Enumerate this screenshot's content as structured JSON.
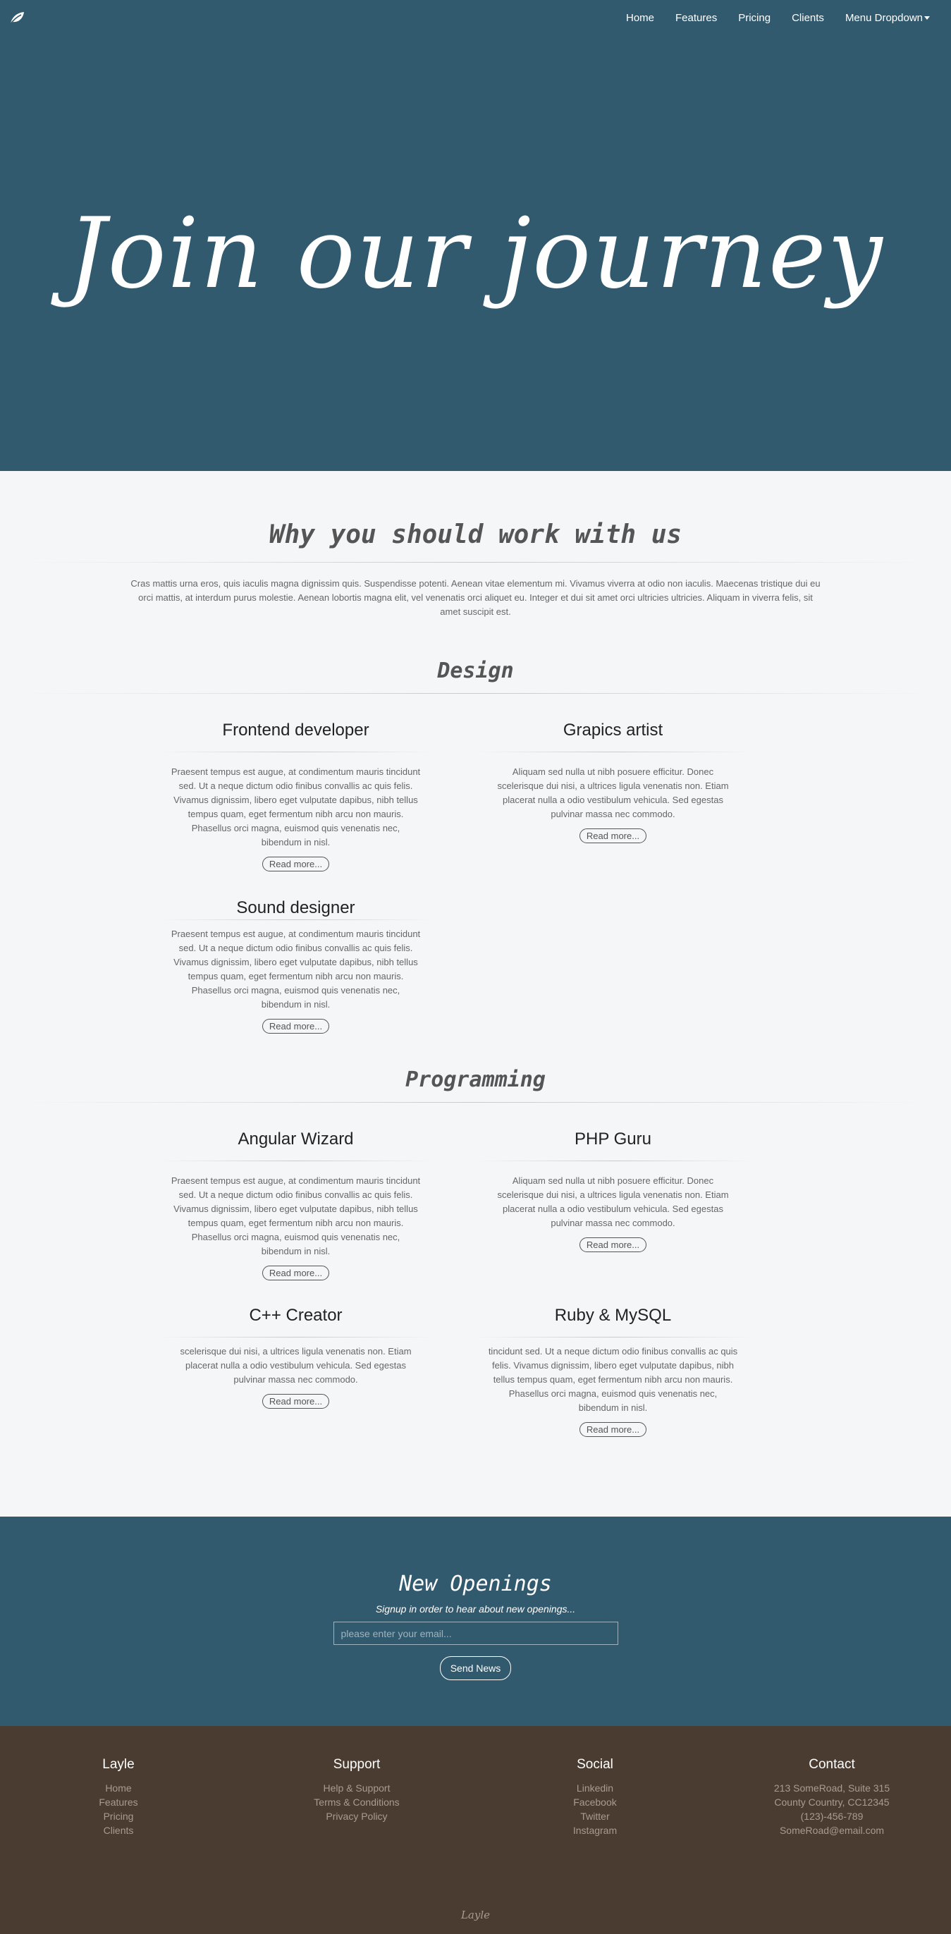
{
  "nav": {
    "items": [
      "Home",
      "Features",
      "Pricing",
      "Clients",
      "Menu Dropdown"
    ]
  },
  "hero": {
    "title": "Join our journey"
  },
  "why": {
    "title": "Why you should work with us",
    "text": "Cras mattis urna eros, quis iaculis magna dignissim quis. Suspendisse potenti. Aenean vitae elementum mi. Vivamus viverra at odio non iaculis. Maecenas tristique dui eu orci mattis, at interdum purus molestie. Aenean lobortis magna elit, vel venenatis orci aliquet eu. Integer et dui sit amet orci ultricies ultricies. Aliquam in viverra felis, sit amet suscipit est."
  },
  "design": {
    "title": "Design",
    "cards": [
      {
        "title": "Frontend developer",
        "text": "Praesent tempus est augue, at condimentum mauris tincidunt sed. Ut a neque dictum odio finibus convallis ac quis felis. Vivamus dignissim, libero eget vulputate dapibus, nibh tellus tempus quam, eget fermentum nibh arcu non mauris. Phasellus orci magna, euismod quis venenatis nec, bibendum in nisl.",
        "button": "Read more..."
      },
      {
        "title": "Grapics artist",
        "text": "Aliquam sed nulla ut nibh posuere efficitur. Donec scelerisque dui nisi, a ultrices ligula venenatis non. Etiam placerat nulla a odio vestibulum vehicula. Sed egestas pulvinar massa nec commodo.",
        "button": "Read more..."
      },
      {
        "title": "Sound designer",
        "text": "Praesent tempus est augue, at condimentum mauris tincidunt sed. Ut a neque dictum odio finibus convallis ac quis felis. Vivamus dignissim, libero eget vulputate dapibus, nibh tellus tempus quam, eget fermentum nibh arcu non mauris. Phasellus orci magna, euismod quis venenatis nec, bibendum in nisl.",
        "button": "Read more..."
      }
    ]
  },
  "programming": {
    "title": "Programming",
    "cards": [
      {
        "title": "Angular Wizard",
        "text": "Praesent tempus est augue, at condimentum mauris tincidunt sed. Ut a neque dictum odio finibus convallis ac quis felis. Vivamus dignissim, libero eget vulputate dapibus, nibh tellus tempus quam, eget fermentum nibh arcu non mauris. Phasellus orci magna, euismod quis venenatis nec, bibendum in nisl.",
        "button": "Read more..."
      },
      {
        "title": "PHP Guru",
        "text": "Aliquam sed nulla ut nibh posuere efficitur. Donec scelerisque dui nisi, a ultrices ligula venenatis non. Etiam placerat nulla a odio vestibulum vehicula. Sed egestas pulvinar massa nec commodo.",
        "button": "Read more..."
      },
      {
        "title": "C++ Creator",
        "text": "scelerisque dui nisi, a ultrices ligula venenatis non. Etiam placerat nulla a odio vestibulum vehicula. Sed egestas pulvinar massa nec commodo.",
        "button": "Read more..."
      },
      {
        "title": "Ruby & MySQL",
        "text": "tincidunt sed. Ut a neque dictum odio finibus convallis ac quis felis. Vivamus dignissim, libero eget vulputate dapibus, nibh tellus tempus quam, eget fermentum nibh arcu non mauris. Phasellus orci magna, euismod quis venenatis nec, bibendum in nisl.",
        "button": "Read more..."
      }
    ]
  },
  "newsletter": {
    "title": "New Openings",
    "subtitle": "Signup in order to hear about new openings...",
    "placeholder": "please enter your email...",
    "button": "Send News"
  },
  "footer": {
    "columns": [
      {
        "title": "Layle",
        "items": [
          "Home",
          "Features",
          "Pricing",
          "Clients"
        ]
      },
      {
        "title": "Support",
        "items": [
          "Help & Support",
          "Terms & Conditions",
          "Privacy Policy"
        ]
      },
      {
        "title": "Social",
        "items": [
          "Linkedin",
          "Facebook",
          "Twitter",
          "Instagram"
        ]
      },
      {
        "title": "Contact",
        "items": [
          "213 SomeRoad, Suite 315",
          "County Country, CC12345",
          "(123)-456-789",
          "SomeRoad@email.com"
        ]
      }
    ],
    "brand": "Layle"
  },
  "colors": {
    "primary": "#325a6f",
    "footer": "#4a3c31",
    "background": "#f5f6f8"
  },
  "icons": {
    "logo": "leaf-icon"
  }
}
